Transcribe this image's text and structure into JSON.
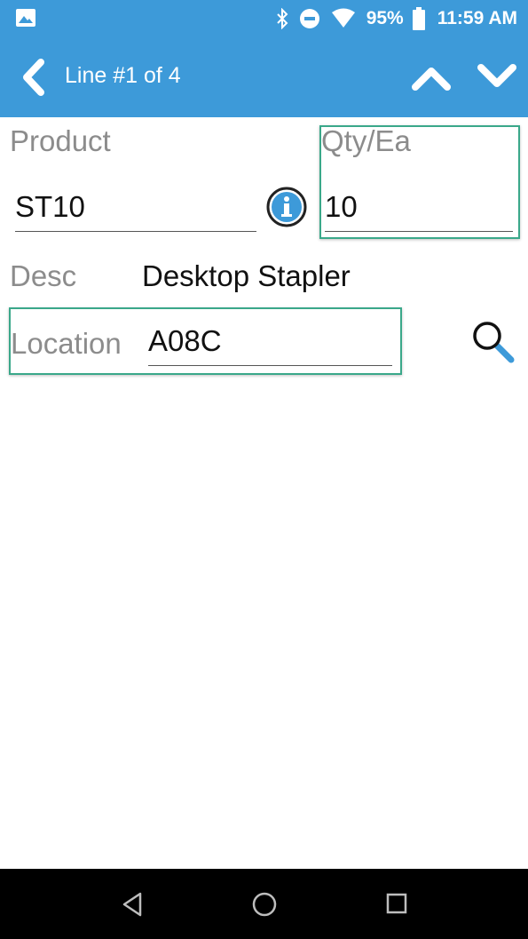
{
  "status_bar": {
    "battery_percent": "95%",
    "time": "11:59 AM",
    "icons": [
      "image-icon",
      "bluetooth-icon",
      "do-not-disturb-icon",
      "wifi-icon",
      "battery-icon"
    ]
  },
  "app_bar": {
    "title": "Line #1 of 4",
    "icons": [
      "back-chevron-icon",
      "chevron-up-icon",
      "chevron-down-icon"
    ]
  },
  "form": {
    "product": {
      "label": "Product",
      "value": "ST10"
    },
    "qty": {
      "label": "Qty/Ea",
      "value": "10"
    },
    "desc": {
      "label": "Desc",
      "value": "Desktop Stapler"
    },
    "location": {
      "label": "Location",
      "value": "A08C"
    },
    "icons": [
      "info-icon",
      "search-icon"
    ]
  },
  "nav_bar": {
    "icons": [
      "nav-back-icon",
      "nav-home-icon",
      "nav-recents-icon"
    ]
  },
  "colors": {
    "primary": "#3d9ad9",
    "highlight_border": "#3aa88a",
    "label_gray": "#8c8c8c"
  }
}
